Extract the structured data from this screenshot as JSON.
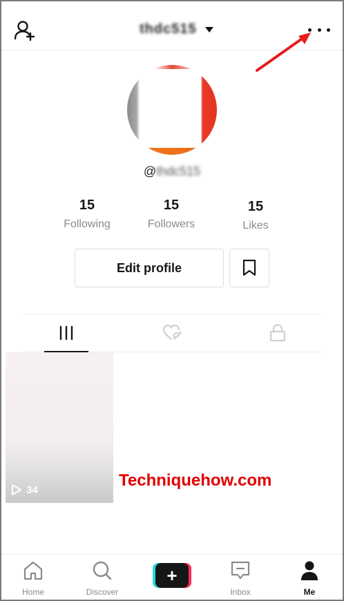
{
  "header": {
    "username": "thdc515",
    "icons": {
      "add_user": "add-user-icon",
      "dropdown": "chevron-down-icon",
      "more": "more-options-icon"
    },
    "annotation_color": "#e81c1c"
  },
  "profile": {
    "handle_prefix": "@",
    "handle_rest": "thdc515",
    "stats": [
      {
        "value": "15",
        "label": "Following"
      },
      {
        "value": "15",
        "label": "Followers"
      },
      {
        "value": "15",
        "label": "Likes"
      }
    ],
    "edit_profile_label": "Edit profile",
    "bookmark_icon": "bookmark-icon"
  },
  "tabs": [
    {
      "name": "videos",
      "icon": "grid-icon",
      "active": true
    },
    {
      "name": "liked",
      "icon": "heart-hidden-icon",
      "active": false
    },
    {
      "name": "private",
      "icon": "lock-icon",
      "active": false
    }
  ],
  "videos": [
    {
      "play_count": "34",
      "icon": "play-icon"
    }
  ],
  "watermark": "Techniquehow.com",
  "bottom_nav": {
    "home": "Home",
    "discover": "Discover",
    "create": "+",
    "inbox": "Inbox",
    "me": "Me"
  },
  "colors": {
    "accent_red": "#e00000",
    "create_cyan": "#25d9e4",
    "create_pink": "#fe2c55",
    "text_primary": "#161616",
    "text_secondary": "#8a8a8a"
  }
}
